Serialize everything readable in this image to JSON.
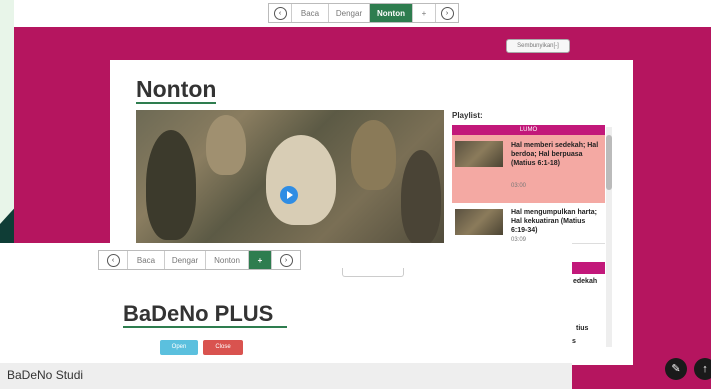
{
  "top_nav": {
    "prev_icon": "chevron-left-circle-icon",
    "prev_glyph": "‹",
    "items": [
      "Baca",
      "Dengar",
      "Nonton",
      "+"
    ],
    "active": "Nonton",
    "next_icon": "chevron-right-circle-icon",
    "next_glyph": "›"
  },
  "toggle_pill": "Sembunyikan[-]",
  "main": {
    "title": "Nonton",
    "video": {
      "play_icon": "play-icon"
    },
    "playlist": {
      "label": "Playlist:",
      "group_header": "LUMO",
      "items": [
        {
          "title": "Hal memberi sedekah; Hal berdoa; Hal berpuasa (Matius 6:1-18)",
          "duration": "03:00",
          "selected": true
        },
        {
          "title": "Hal mengumpulkan harta; Hal kekuatiran (Matius 6:19-34)",
          "duration": "03:09",
          "selected": false
        }
      ],
      "partial_texts": [
        "edekah",
        "tius",
        "s"
      ]
    }
  },
  "overlay_window": {
    "nav": {
      "items": [
        "Baca",
        "Dengar",
        "Nonton",
        "+"
      ],
      "active": "+"
    },
    "title": "BaDeNo PLUS",
    "open_button": "Open",
    "close_button": "Close",
    "bar_label": "BaDeNo Studi"
  },
  "fabs": {
    "edit_icon": "pencil-icon",
    "edit_glyph": "✎",
    "up_icon": "arrow-up-icon",
    "up_glyph": "↑"
  },
  "colors": {
    "magenta": "#b5155f",
    "active_green": "#2e7d4f",
    "playlist_header": "#c2187a",
    "selected_item": "#f4a9a3"
  }
}
